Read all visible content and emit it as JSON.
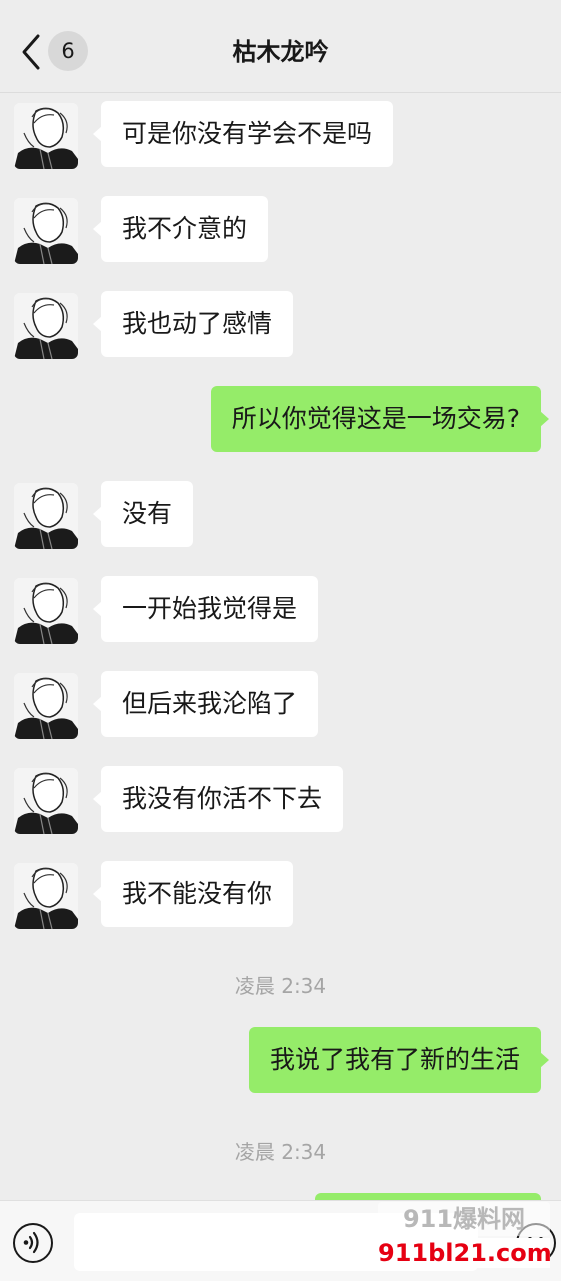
{
  "header": {
    "unread_count": "6",
    "title": "枯木龙吟"
  },
  "messages": [
    {
      "side": "in",
      "text": "可是你没有学会不是吗"
    },
    {
      "side": "in",
      "text": "我不介意的"
    },
    {
      "side": "in",
      "text": "我也动了感情"
    },
    {
      "side": "out",
      "text": "所以你觉得这是一场交易?"
    },
    {
      "side": "in",
      "text": "没有"
    },
    {
      "side": "in",
      "text": "一开始我觉得是"
    },
    {
      "side": "in",
      "text": "但后来我沦陷了"
    },
    {
      "side": "in",
      "text": "我没有你活不下去"
    },
    {
      "side": "in",
      "text": "我不能没有你"
    },
    {
      "type": "time",
      "text": "凌晨 2:34"
    },
    {
      "side": "out",
      "text": "我说了我有了新的生活"
    },
    {
      "type": "time",
      "text": "凌晨 2:34"
    }
  ],
  "input_bar": {
    "voice_icon": "voice-icon",
    "emoji_icon": "emoji-icon",
    "text_value": ""
  },
  "watermark": {
    "logo_text": "911爆料网",
    "url": "911bl21.com"
  },
  "colors": {
    "background": "#ededed",
    "outgoing_bubble": "#95ec69",
    "incoming_bubble": "#ffffff",
    "timestamp": "#a5a5a5",
    "watermark_url": "#e60012"
  }
}
